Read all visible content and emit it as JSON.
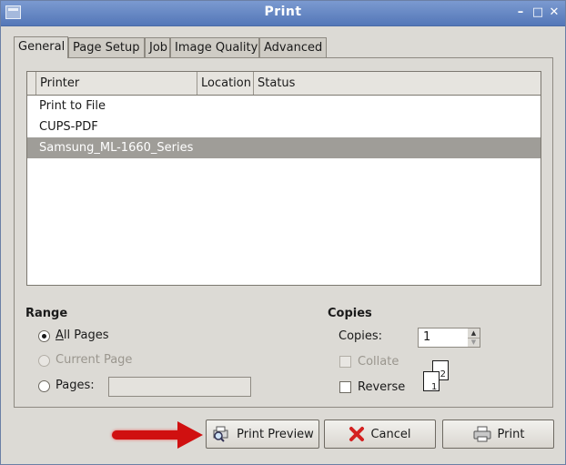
{
  "window": {
    "title": "Print"
  },
  "tabs": [
    {
      "label": "General",
      "active": true
    },
    {
      "label": "Page Setup",
      "active": false
    },
    {
      "label": "Job",
      "active": false
    },
    {
      "label": "Image Quality",
      "active": false
    },
    {
      "label": "Advanced",
      "active": false
    }
  ],
  "printer_list": {
    "columns": [
      "Printer",
      "Location",
      "Status"
    ],
    "rows": [
      {
        "printer": "Print to File",
        "location": "",
        "status": "",
        "selected": false
      },
      {
        "printer": "CUPS-PDF",
        "location": "",
        "status": "",
        "selected": false
      },
      {
        "printer": "Samsung_ML-1660_Series",
        "location": "",
        "status": "",
        "selected": true
      }
    ]
  },
  "range": {
    "title": "Range",
    "all_pages": {
      "label": "All Pages",
      "checked": true,
      "enabled": true
    },
    "current_page": {
      "label": "Current Page",
      "checked": false,
      "enabled": false
    },
    "pages": {
      "label": "Pages:",
      "checked": false,
      "enabled": true,
      "value": ""
    }
  },
  "copies": {
    "title": "Copies",
    "label": "Copies:",
    "value": "1",
    "collate": {
      "label": "Collate",
      "checked": false,
      "enabled": false
    },
    "reverse": {
      "label": "Reverse",
      "checked": false,
      "enabled": true
    },
    "preview_pages": [
      "2",
      "1"
    ]
  },
  "buttons": {
    "print_preview": "Print Preview",
    "cancel": "Cancel",
    "print": "Print"
  },
  "colors": {
    "titlebar": "#5477b8",
    "selection": "#9f9d98",
    "annotation_arrow": "#d01010"
  },
  "icons": {
    "print_preview": "magnifier-printer-icon",
    "cancel": "red-x-icon",
    "print": "printer-icon",
    "annotation": "red-arrow-pointer"
  }
}
